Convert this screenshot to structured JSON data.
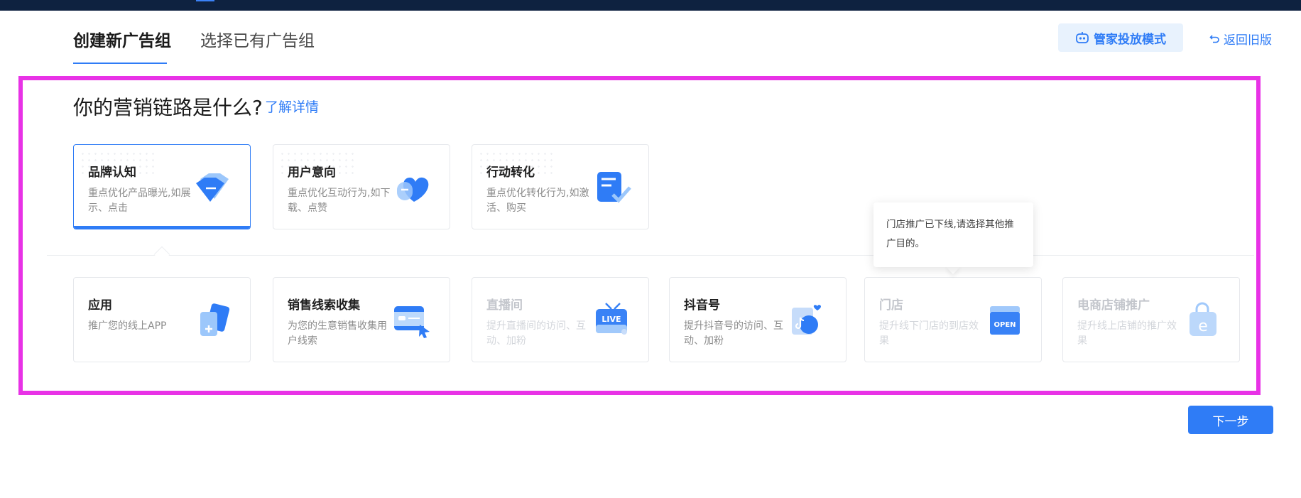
{
  "tabs": [
    {
      "label": "创建新广告组",
      "active": true
    },
    {
      "label": "选择已有广告组",
      "active": false
    }
  ],
  "header": {
    "manager_mode_label": "管家投放模式",
    "back_label": "返回旧版"
  },
  "question": {
    "title": "你的营销链路是什么?",
    "learn_more": "了解详情"
  },
  "marketing_chain": [
    {
      "title": "品牌认知",
      "desc": "重点优化产品曝光,如展示、点击",
      "icon": "diamond-icon",
      "selected": true
    },
    {
      "title": "用户意向",
      "desc": "重点优化互动行为,如下载、点赞",
      "icon": "heart-user-icon",
      "selected": false
    },
    {
      "title": "行动转化",
      "desc": "重点优化转化行为,如激活、购买",
      "icon": "document-check-icon",
      "selected": false
    }
  ],
  "promotion_targets": [
    {
      "title": "应用",
      "desc": "推广您的线上APP",
      "icon": "app-add-icon",
      "disabled": false
    },
    {
      "title": "销售线索收集",
      "desc": "为您的生意销售收集用户线索",
      "icon": "card-click-icon",
      "disabled": false
    },
    {
      "title": "直播间",
      "desc": "提升直播间的访问、互动、加粉",
      "icon": "live-tv-icon",
      "disabled": true
    },
    {
      "title": "抖音号",
      "desc": "提升抖音号的访问、互动、加粉",
      "icon": "douyin-icon",
      "disabled": false
    },
    {
      "title": "门店",
      "desc": "提升线下门店的到店效果",
      "icon": "open-store-icon",
      "disabled": true
    },
    {
      "title": "电商店铺推广",
      "desc": "提升线上店铺的推广效果",
      "icon": "shop-bag-icon",
      "disabled": true
    }
  ],
  "tooltip": {
    "text": "门店推广已下线,请选择其他推广目的。"
  },
  "footer": {
    "next_label": "下一步"
  },
  "colors": {
    "primary": "#2f7cf6",
    "highlight_border": "#e832e6",
    "topbar": "#0e2240"
  }
}
